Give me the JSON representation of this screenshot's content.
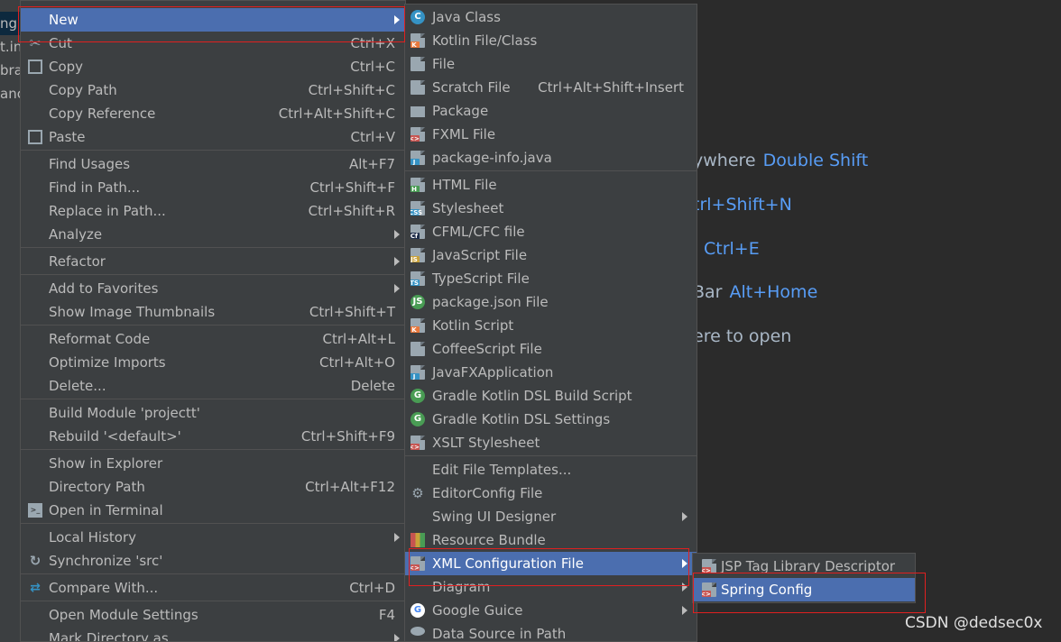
{
  "project_tree": {
    "rows": [
      {
        "text": "ng",
        "selected": true
      },
      {
        "text": "t.in",
        "selected": false
      },
      {
        "text": "bra",
        "selected": false
      },
      {
        "text": "anc",
        "selected": false
      }
    ]
  },
  "editor_hints": [
    {
      "text": "ywhere",
      "key": "Double Shift"
    },
    {
      "text": "",
      "key": "trl+Shift+N"
    },
    {
      "text": "",
      "key": "Ctrl+E"
    },
    {
      "text": "Bar",
      "key": "Alt+Home"
    },
    {
      "text": "ere to open",
      "key": ""
    }
  ],
  "watermark": "CSDN @dedsec0x",
  "context_menu": {
    "items": [
      {
        "label": "New",
        "shortcut": "",
        "submenu": true,
        "selected": true,
        "icon": ""
      },
      {
        "label": "Cut",
        "shortcut": "Ctrl+X",
        "submenu": false,
        "selected": false,
        "icon": "scissors-icon"
      },
      {
        "label": "Copy",
        "shortcut": "Ctrl+C",
        "submenu": false,
        "selected": false,
        "icon": "copy-icon"
      },
      {
        "label": "Copy Path",
        "shortcut": "Ctrl+Shift+C",
        "submenu": false,
        "selected": false,
        "icon": ""
      },
      {
        "label": "Copy Reference",
        "shortcut": "Ctrl+Alt+Shift+C",
        "submenu": false,
        "selected": false,
        "icon": ""
      },
      {
        "label": "Paste",
        "shortcut": "Ctrl+V",
        "submenu": false,
        "selected": false,
        "icon": "clipboard-icon"
      },
      {
        "label": "Find Usages",
        "shortcut": "Alt+F7",
        "submenu": false,
        "selected": false,
        "icon": ""
      },
      {
        "label": "Find in Path...",
        "shortcut": "Ctrl+Shift+F",
        "submenu": false,
        "selected": false,
        "icon": ""
      },
      {
        "label": "Replace in Path...",
        "shortcut": "Ctrl+Shift+R",
        "submenu": false,
        "selected": false,
        "icon": ""
      },
      {
        "label": "Analyze",
        "shortcut": "",
        "submenu": true,
        "selected": false,
        "icon": ""
      },
      {
        "label": "Refactor",
        "shortcut": "",
        "submenu": true,
        "selected": false,
        "icon": ""
      },
      {
        "label": "Add to Favorites",
        "shortcut": "",
        "submenu": true,
        "selected": false,
        "icon": ""
      },
      {
        "label": "Show Image Thumbnails",
        "shortcut": "Ctrl+Shift+T",
        "submenu": false,
        "selected": false,
        "icon": ""
      },
      {
        "label": "Reformat Code",
        "shortcut": "Ctrl+Alt+L",
        "submenu": false,
        "selected": false,
        "icon": ""
      },
      {
        "label": "Optimize Imports",
        "shortcut": "Ctrl+Alt+O",
        "submenu": false,
        "selected": false,
        "icon": ""
      },
      {
        "label": "Delete...",
        "shortcut": "Delete",
        "submenu": false,
        "selected": false,
        "icon": ""
      },
      {
        "label": "Build Module 'projectt'",
        "shortcut": "",
        "submenu": false,
        "selected": false,
        "icon": ""
      },
      {
        "label": "Rebuild '<default>'",
        "shortcut": "Ctrl+Shift+F9",
        "submenu": false,
        "selected": false,
        "icon": ""
      },
      {
        "label": "Show in Explorer",
        "shortcut": "",
        "submenu": false,
        "selected": false,
        "icon": ""
      },
      {
        "label": "Directory Path",
        "shortcut": "Ctrl+Alt+F12",
        "submenu": false,
        "selected": false,
        "icon": ""
      },
      {
        "label": "Open in Terminal",
        "shortcut": "",
        "submenu": false,
        "selected": false,
        "icon": "terminal-icon"
      },
      {
        "label": "Local History",
        "shortcut": "",
        "submenu": true,
        "selected": false,
        "icon": ""
      },
      {
        "label": "Synchronize 'src'",
        "shortcut": "",
        "submenu": false,
        "selected": false,
        "icon": "sync-icon"
      },
      {
        "label": "Compare With...",
        "shortcut": "Ctrl+D",
        "submenu": false,
        "selected": false,
        "icon": "compare-icon"
      },
      {
        "label": "Open Module Settings",
        "shortcut": "F4",
        "submenu": false,
        "selected": false,
        "icon": ""
      },
      {
        "label": "Mark Directory as",
        "shortcut": "",
        "submenu": true,
        "selected": false,
        "icon": ""
      }
    ]
  },
  "new_submenu": {
    "items": [
      {
        "label": "Java Class",
        "shortcut": "",
        "submenu": false,
        "selected": false,
        "icon": "java-class-icon",
        "badge": "C",
        "color": "#3592c4"
      },
      {
        "label": "Kotlin File/Class",
        "shortcut": "",
        "submenu": false,
        "selected": false,
        "icon": "kotlin-file-icon",
        "badge": "K",
        "color": "#e8783c"
      },
      {
        "label": "File",
        "shortcut": "",
        "submenu": false,
        "selected": false,
        "icon": "file-icon",
        "badge": "",
        "color": ""
      },
      {
        "label": "Scratch File",
        "shortcut": "Ctrl+Alt+Shift+Insert",
        "submenu": false,
        "selected": false,
        "icon": "scratch-file-icon",
        "badge": "",
        "color": "#3592c4"
      },
      {
        "label": "Package",
        "shortcut": "",
        "submenu": false,
        "selected": false,
        "icon": "package-icon",
        "badge": "",
        "color": ""
      },
      {
        "label": "FXML File",
        "shortcut": "",
        "submenu": false,
        "selected": false,
        "icon": "fxml-file-icon",
        "badge": "<>",
        "color": "#c75450"
      },
      {
        "label": "package-info.java",
        "shortcut": "",
        "submenu": false,
        "selected": false,
        "icon": "java-file-icon",
        "badge": "J",
        "color": "#3592c4"
      },
      {
        "label": "HTML File",
        "shortcut": "",
        "submenu": false,
        "selected": false,
        "icon": "html-file-icon",
        "badge": "H",
        "color": "#499c54"
      },
      {
        "label": "Stylesheet",
        "shortcut": "",
        "submenu": false,
        "selected": false,
        "icon": "css-file-icon",
        "badge": "CSS",
        "color": "#3592c4"
      },
      {
        "label": "CFML/CFC file",
        "shortcut": "",
        "submenu": false,
        "selected": false,
        "icon": "cfml-file-icon",
        "badge": "Cf",
        "color": "#1e2d4a"
      },
      {
        "label": "JavaScript File",
        "shortcut": "",
        "submenu": false,
        "selected": false,
        "icon": "javascript-file-icon",
        "badge": "JS",
        "color": "#c9a23a"
      },
      {
        "label": "TypeScript File",
        "shortcut": "",
        "submenu": false,
        "selected": false,
        "icon": "typescript-file-icon",
        "badge": "TS",
        "color": "#3592c4"
      },
      {
        "label": "package.json File",
        "shortcut": "",
        "submenu": false,
        "selected": false,
        "icon": "nodejs-icon",
        "badge": "JS",
        "color": "#499c54"
      },
      {
        "label": "Kotlin Script",
        "shortcut": "",
        "submenu": false,
        "selected": false,
        "icon": "kotlin-script-icon",
        "badge": "K",
        "color": "#e8783c"
      },
      {
        "label": "CoffeeScript File",
        "shortcut": "",
        "submenu": false,
        "selected": false,
        "icon": "coffeescript-file-icon",
        "badge": "",
        "color": "#3592c4"
      },
      {
        "label": "JavaFXApplication",
        "shortcut": "",
        "submenu": false,
        "selected": false,
        "icon": "javafx-file-icon",
        "badge": "J",
        "color": "#3592c4"
      },
      {
        "label": "Gradle Kotlin DSL Build Script",
        "shortcut": "",
        "submenu": false,
        "selected": false,
        "icon": "gradle-icon",
        "badge": "G",
        "color": "#499c54"
      },
      {
        "label": "Gradle Kotlin DSL Settings",
        "shortcut": "",
        "submenu": false,
        "selected": false,
        "icon": "gradle-icon",
        "badge": "G",
        "color": "#499c54"
      },
      {
        "label": "XSLT Stylesheet",
        "shortcut": "",
        "submenu": false,
        "selected": false,
        "icon": "xslt-file-icon",
        "badge": "<>",
        "color": "#c75450"
      },
      {
        "label": "Edit File Templates...",
        "shortcut": "",
        "submenu": false,
        "selected": false,
        "icon": "",
        "badge": "",
        "color": ""
      },
      {
        "label": "EditorConfig File",
        "shortcut": "",
        "submenu": false,
        "selected": false,
        "icon": "gear-icon",
        "badge": "",
        "color": ""
      },
      {
        "label": "Swing UI Designer",
        "shortcut": "",
        "submenu": true,
        "selected": false,
        "icon": "",
        "badge": "",
        "color": ""
      },
      {
        "label": "Resource Bundle",
        "shortcut": "",
        "submenu": false,
        "selected": false,
        "icon": "resource-bundle-icon",
        "badge": "",
        "color": "#c9a23a"
      },
      {
        "label": "XML Configuration File",
        "shortcut": "",
        "submenu": true,
        "selected": true,
        "icon": "xml-file-icon",
        "badge": "<>",
        "color": "#c75450"
      },
      {
        "label": "Diagram",
        "shortcut": "",
        "submenu": true,
        "selected": false,
        "icon": "",
        "badge": "",
        "color": ""
      },
      {
        "label": "Google Guice",
        "shortcut": "",
        "submenu": true,
        "selected": false,
        "icon": "google-icon",
        "badge": "G",
        "color": "#4285f4"
      },
      {
        "label": "Data Source in Path",
        "shortcut": "",
        "submenu": false,
        "selected": false,
        "icon": "database-icon",
        "badge": "",
        "color": "#3592c4"
      }
    ]
  },
  "xml_submenu": {
    "items": [
      {
        "label": "JSP Tag Library Descriptor",
        "selected": false,
        "icon": "jsp-tag-icon",
        "badge": "<>",
        "color": "#c75450"
      },
      {
        "label": "Spring Config",
        "selected": true,
        "icon": "spring-config-icon",
        "badge": "<>",
        "color": "#c75450"
      }
    ]
  },
  "colors": {
    "menu_bg": "#3c3f41",
    "selection": "#4b6eaf",
    "editor_bg": "#2b2b2b",
    "hint_key": "#589df6",
    "highlight_box": "#e02020"
  }
}
